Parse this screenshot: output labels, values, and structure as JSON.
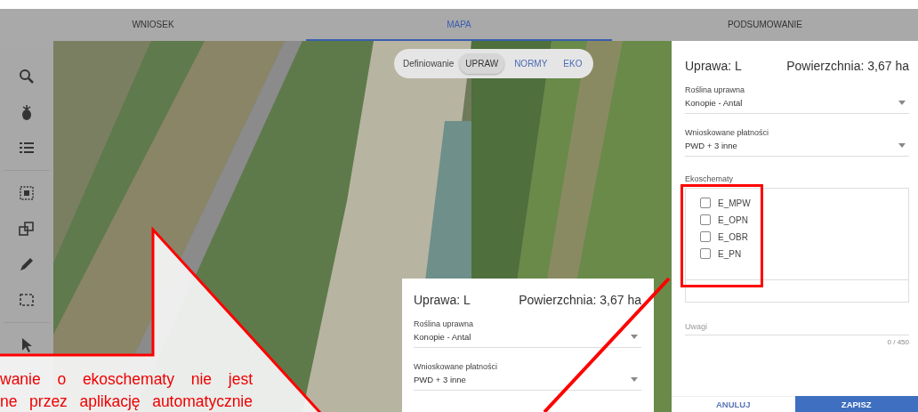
{
  "tabs": [
    {
      "label": "WNIOSEK",
      "selected": false
    },
    {
      "label": "MAPA",
      "selected": true
    },
    {
      "label": "PODSUMOWANIE",
      "selected": false
    }
  ],
  "map_mode_switch": {
    "label": "Definiowanie",
    "options": [
      {
        "label": "UPRAW",
        "selected": true
      },
      {
        "label": "NORMY",
        "selected": false
      },
      {
        "label": "EKO",
        "selected": false
      }
    ]
  },
  "crop_panel": {
    "crop": "Uprawa: L",
    "area": "Powierzchnia: 3,67 ha",
    "fields": [
      {
        "label": "Roślina uprawna",
        "value": "Konopie - Antal"
      },
      {
        "label": "Wnioskowane płatności",
        "value": "PWD + 3 inne"
      }
    ],
    "ecoschemes": {
      "label": "Ekoschematy",
      "options": [
        {
          "label": "E_MPW",
          "checked": false
        },
        {
          "label": "E_OPN",
          "checked": false
        },
        {
          "label": "E_OBR",
          "checked": false
        },
        {
          "label": "E_PN",
          "checked": false
        }
      ]
    },
    "notes": {
      "placeholder": "Uwagi",
      "counter": "0 / 450"
    },
    "buttons": [
      {
        "label": "ANULUJ",
        "kind": "secondary"
      },
      {
        "label": "ZAPISZ",
        "kind": "primary"
      }
    ]
  },
  "zoom_inset": {
    "crop": "Uprawa: L",
    "area": "Powierzchnia: 3,67 ha",
    "fields": [
      {
        "label": "Roślina uprawna",
        "value": "Konopie - Antal"
      },
      {
        "label": "Wnioskowane płatności",
        "value": "PWD + 3 inne"
      }
    ]
  },
  "callout": {
    "lines": [
      "wanie o ekoschematy nie jest",
      "ne przez aplikację automatycznie"
    ]
  }
}
